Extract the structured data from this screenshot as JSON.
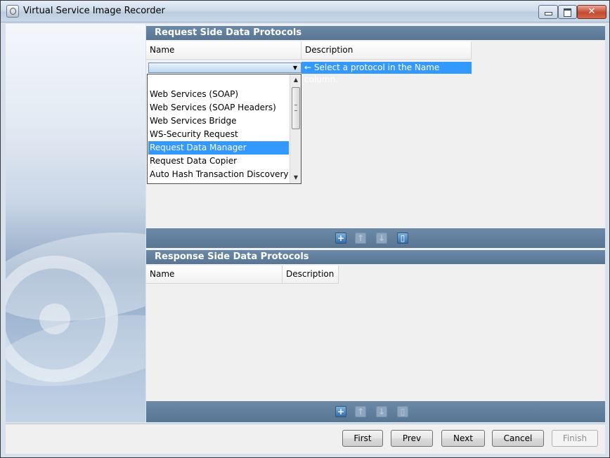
{
  "window": {
    "title": "Virtual Service Image Recorder"
  },
  "request_section": {
    "title": "Request Side Data Protocols",
    "columns": [
      "Name",
      "Description"
    ],
    "hint": "← Select a protocol in the Name column.",
    "combo_value": "",
    "dropdown_options": [
      "Web Services (SOAP)",
      "Web Services (SOAP Headers)",
      "Web Services Bridge",
      "WS-Security Request",
      "Request Data Manager",
      "Request Data Copier",
      "Auto Hash Transaction Discovery"
    ],
    "selected_option": "Request Data Manager"
  },
  "response_section": {
    "title": "Response Side Data Protocols",
    "columns": [
      "Name",
      "Description"
    ]
  },
  "toolbar_icons": [
    "add-icon",
    "move-up-icon",
    "move-down-icon",
    "delete-icon"
  ],
  "buttons": {
    "first": "First",
    "prev": "Prev",
    "next": "Next",
    "cancel": "Cancel",
    "finish": "Finish"
  }
}
